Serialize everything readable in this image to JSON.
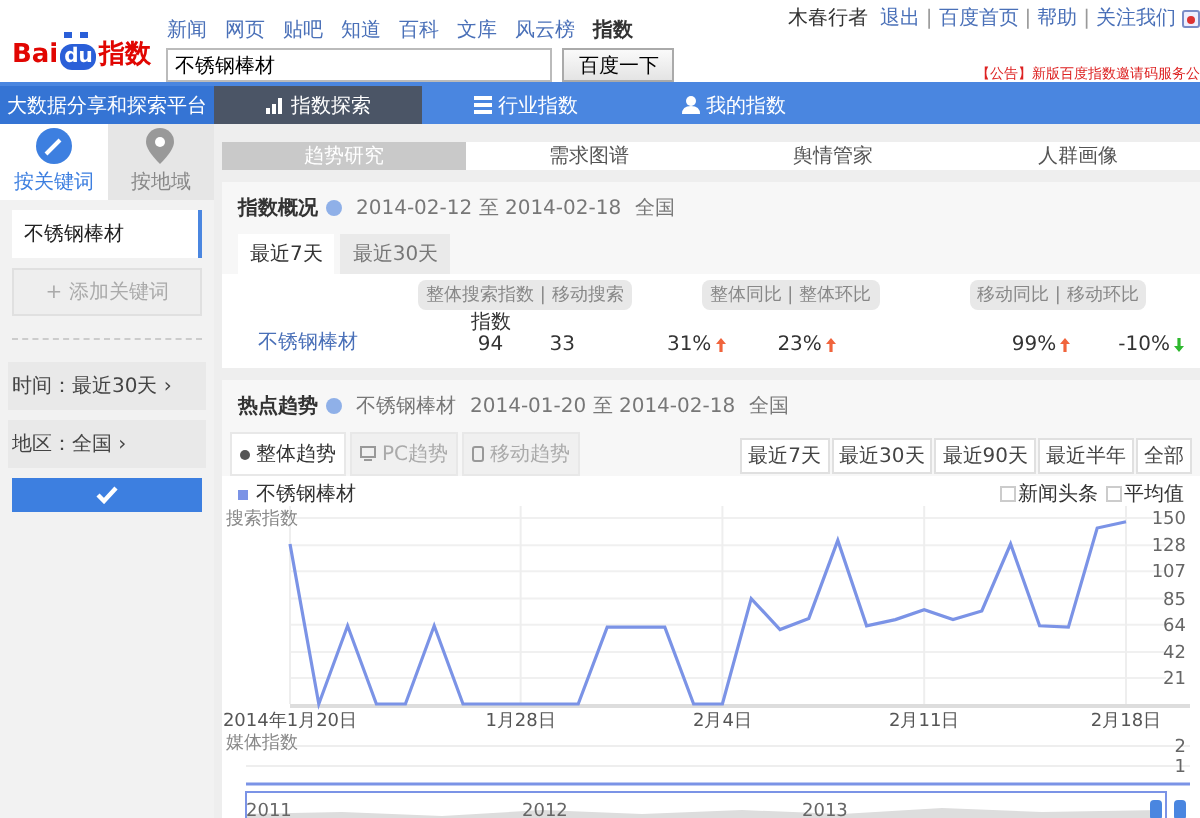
{
  "logo": {
    "part1": "Bai",
    "part2": "du",
    "part3": "指数"
  },
  "top_nav": [
    {
      "label": "新闻",
      "selected": false
    },
    {
      "label": "网页",
      "selected": false
    },
    {
      "label": "贴吧",
      "selected": false
    },
    {
      "label": "知道",
      "selected": false
    },
    {
      "label": "百科",
      "selected": false
    },
    {
      "label": "文库",
      "selected": false
    },
    {
      "label": "风云榜",
      "selected": false
    },
    {
      "label": "指数",
      "selected": true
    }
  ],
  "search": {
    "value": "不锈钢棒材",
    "button": "百度一下"
  },
  "user_links": [
    {
      "label": "木春行者",
      "kind": "text"
    },
    {
      "label": "退出",
      "kind": "link"
    },
    {
      "label": "|",
      "kind": "separator"
    },
    {
      "label": "百度首页",
      "kind": "link"
    },
    {
      "label": "|",
      "kind": "separator"
    },
    {
      "label": "帮助",
      "kind": "link"
    },
    {
      "label": "|",
      "kind": "separator"
    },
    {
      "label": "关注我们",
      "kind": "link"
    }
  ],
  "announcement": "【公告】新版百度指数邀请码服务公",
  "main_nav": {
    "brand": "大数据分享和探索平台",
    "tabs": [
      {
        "label": "指数探索",
        "selected": true,
        "kind": "bars"
      },
      {
        "label": "行业指数",
        "selected": false,
        "kind": "list"
      },
      {
        "label": "我的指数",
        "selected": false,
        "kind": "user"
      }
    ]
  },
  "sidebar": {
    "tabs": [
      {
        "label": "按关键词",
        "selected": true,
        "kind": "pen"
      },
      {
        "label": "按地域",
        "selected": false,
        "kind": "pin"
      }
    ],
    "keyword": "不锈钢棒材",
    "add_keyword": "+ 添加关键词",
    "filters": [
      "时间：最近30天 ›",
      "地区：全国 ›"
    ]
  },
  "sub_tabs": [
    {
      "label": "趋势研究",
      "selected": true
    },
    {
      "label": "需求图谱",
      "selected": false
    },
    {
      "label": "舆情管家",
      "selected": false
    },
    {
      "label": "人群画像",
      "selected": false
    }
  ],
  "overview": {
    "title": "指数概况",
    "date_range": "2014-02-12 至 2014-02-18",
    "region": "全国",
    "tabs": [
      {
        "label": "最近7天",
        "selected": true
      },
      {
        "label": "最近30天",
        "selected": false
      }
    ],
    "headers": [
      "整体搜索指数 | 移动搜索",
      "整体同比 | 整体环比",
      "移动同比 | 移动环比"
    ],
    "row": {
      "keyword": "不锈钢棒材",
      "index_label": "指数",
      "overall": "94",
      "mobile": "33",
      "changes": [
        {
          "value": "31%",
          "kind": "up"
        },
        {
          "value": "23%",
          "kind": "up"
        },
        {
          "value": "99%",
          "kind": "up"
        },
        {
          "value": "-10%",
          "kind": "down"
        }
      ]
    }
  },
  "trend": {
    "title": "热点趋势",
    "keyword": "不锈钢棒材",
    "date_range": "2014-01-20 至 2014-02-18",
    "region": "全国",
    "tabs": [
      {
        "label": "整体趋势",
        "selected": true,
        "kind": "dot"
      },
      {
        "label": "PC趋势",
        "selected": false,
        "kind": "monitor"
      },
      {
        "label": "移动趋势",
        "selected": false,
        "kind": "phone"
      }
    ],
    "ranges": [
      "最近7天",
      "最近30天",
      "最近90天",
      "最近半年",
      "全部"
    ],
    "options": [
      {
        "label": "新闻头条",
        "checked": false
      },
      {
        "label": "平均值",
        "checked": false
      }
    ],
    "chart_data": {
      "type": "line",
      "ylabel": "搜索指数",
      "categories": [
        "2014年1月20日",
        null,
        null,
        null,
        null,
        null,
        null,
        null,
        "1月28日",
        null,
        null,
        null,
        null,
        null,
        null,
        "2月4日",
        null,
        null,
        null,
        null,
        null,
        null,
        "2月11日",
        null,
        null,
        null,
        null,
        null,
        null,
        "2月18日"
      ],
      "grid": true,
      "series": [
        {
          "name": "不锈钢棒材",
          "color": "#7b93e6",
          "values": [
            129,
            0,
            63,
            0,
            0,
            63,
            0,
            0,
            0,
            0,
            0,
            62,
            62,
            62,
            0,
            0,
            85,
            60,
            69,
            132,
            63,
            68,
            76,
            68,
            75,
            129,
            63,
            62,
            142,
            147
          ]
        }
      ],
      "ylim": [
        0,
        150
      ],
      "yticks": [
        21,
        42,
        64,
        85,
        107,
        128,
        150
      ]
    },
    "media": {
      "label": "媒体指数",
      "ticks": [
        "2",
        "1"
      ]
    },
    "navigator": [
      "2011",
      "2012",
      "2013"
    ]
  }
}
